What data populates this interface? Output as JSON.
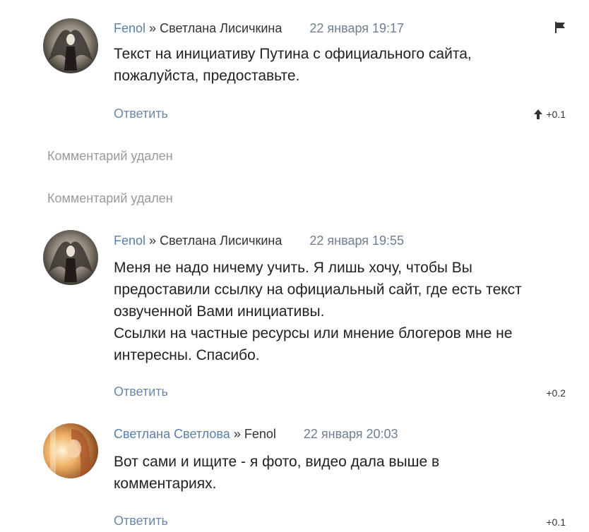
{
  "comments": [
    {
      "author": "Fenol",
      "separator": "»",
      "reply_to": "Светлана Лисичкина",
      "date": "22 января 19:17",
      "text": "Текст на инициативу Путина с официального сайта,\nпожалуйста, предоставьте.",
      "reply_label": "Ответить",
      "rating": "+0.1",
      "avatar_icon": "angel-avatar",
      "rating_icon": "arrow-up-icon",
      "flag_icon": "flag-icon"
    },
    {
      "author": "Fenol",
      "separator": "»",
      "reply_to": "Светлана Лисичкина",
      "date": "22 января 19:55",
      "text": "Меня не надо ничему учить. Я лишь хочу, чтобы Вы\nпредоставили ссылку на официальный сайт, где есть текст\nозвученной Вами инициативы.\nСсылки на частные ресурсы или мнение блогеров мне не\nинтересны. Спасибо.",
      "reply_label": "Ответить",
      "rating": "+0.2",
      "avatar_icon": "angel-avatar"
    },
    {
      "author": "Светлана Светлова",
      "separator": "»",
      "reply_to": "Fenol",
      "date": "22 января 20:03",
      "text": "Вот сами и ищите - я фото, видео дала выше в\nкомментариях.",
      "reply_label": "Ответить",
      "rating": "+0.1",
      "avatar_icon": "woman-avatar"
    }
  ],
  "deleted": [
    {
      "label": "Комментарий удален"
    },
    {
      "label": "Комментарий удален"
    }
  ],
  "colors": {
    "author_link": "#5b7fa6",
    "reply_link": "#6a87a9",
    "deleted_text": "#9a9a9a",
    "date_text": "#6f7f90"
  }
}
